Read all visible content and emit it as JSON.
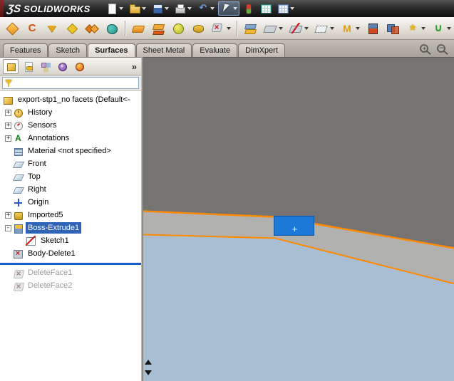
{
  "titlebar": {
    "logo_glyph": "ƷS",
    "brand": "SOLIDWORKS",
    "buttons": [
      {
        "icon": "new-icon",
        "caret": true
      },
      {
        "icon": "open-icon",
        "caret": true
      },
      {
        "icon": "save-icon",
        "caret": true
      },
      {
        "icon": "print-icon",
        "caret": true
      },
      {
        "icon": "undo-icon",
        "caret": true
      },
      {
        "icon": "select-cursor-icon",
        "caret": true,
        "pressed": true
      },
      {
        "icon": "stoplight-icon",
        "caret": false
      },
      {
        "icon": "table-icon",
        "caret": false
      },
      {
        "icon": "window-icon",
        "caret": true
      }
    ]
  },
  "surfaces_toolbar": {
    "buttons": [
      {
        "icon": "extruded-surface-icon"
      },
      {
        "icon": "revolved-surface-icon"
      },
      {
        "icon": "swept-surface-icon"
      },
      {
        "icon": "lofted-surface-icon"
      },
      {
        "icon": "boundary-surface-icon"
      },
      {
        "icon": "filled-surface-icon"
      },
      {
        "separator": true
      },
      {
        "icon": "planar-surface-icon"
      },
      {
        "icon": "offset-surface-icon"
      },
      {
        "icon": "ruled-surface-icon"
      },
      {
        "icon": "radiate-surface-icon"
      },
      {
        "icon": "delete-face-icon",
        "caret": true
      },
      {
        "separator": true
      },
      {
        "icon": "replace-face-icon"
      },
      {
        "icon": "extend-surface-icon",
        "caret": true
      },
      {
        "icon": "trim-surface-icon",
        "caret": true
      },
      {
        "icon": "untrim-surface-icon",
        "caret": true
      },
      {
        "icon": "knit-surface-icon",
        "caret": true
      },
      {
        "icon": "thicken-icon"
      },
      {
        "icon": "intersect-icon"
      },
      {
        "icon": "instant3d-icon",
        "caret": true
      },
      {
        "icon": "curves-icon",
        "caret": true
      }
    ]
  },
  "ribbon_tabs": [
    {
      "label": "Features",
      "active": false
    },
    {
      "label": "Sketch",
      "active": false
    },
    {
      "label": "Surfaces",
      "active": true
    },
    {
      "label": "Sheet Metal",
      "active": false
    },
    {
      "label": "Evaluate",
      "active": false
    },
    {
      "label": "DimXpert",
      "active": false
    }
  ],
  "panel": {
    "tabs": [
      "featuremanager-icon",
      "propertymanager-icon",
      "configurationmanager-icon",
      "dimxpertmanager-icon",
      "displaymanager-icon"
    ],
    "expand_glyph": "»",
    "filter": {
      "value": ""
    },
    "tree": {
      "root": {
        "label": "export-stp1_no facets  (Default<-",
        "icon": "part-icon"
      },
      "items": [
        {
          "label": "History",
          "icon": "history-icon",
          "expander": "+"
        },
        {
          "label": "Sensors",
          "icon": "sensors-icon",
          "expander": "+"
        },
        {
          "label": "Annotations",
          "icon": "annotations-icon",
          "expander": "+"
        },
        {
          "label": "Material <not specified>",
          "icon": "material-icon"
        },
        {
          "label": "Front",
          "icon": "plane-icon"
        },
        {
          "label": "Top",
          "icon": "plane-icon"
        },
        {
          "label": "Right",
          "icon": "plane-icon"
        },
        {
          "label": "Origin",
          "icon": "origin-icon"
        },
        {
          "label": "Imported5",
          "icon": "imported-feature-icon",
          "expander": "+"
        },
        {
          "label": "Boss-Extrude1",
          "icon": "boss-extrude-icon",
          "expander": "-",
          "selected": true
        },
        {
          "label": "Sketch1",
          "icon": "sketch-icon",
          "level": 2
        },
        {
          "label": "Body-Delete1",
          "icon": "body-delete-icon"
        },
        {
          "type": "rollback-bar"
        },
        {
          "label": "DeleteFace1",
          "icon": "delete-face-icon",
          "grayed": true
        },
        {
          "label": "DeleteFace2",
          "icon": "delete-face-icon",
          "grayed": true
        }
      ]
    }
  },
  "viewport": {
    "zoom_icons": [
      "zoom-in-icon",
      "zoom-out-icon"
    ],
    "cursor_glyph": "+",
    "colors": {
      "background": "#757472",
      "chamfer_face": "#b1b1af",
      "bottom_face": "#a9bed3",
      "highlight_edge": "#ff8a00",
      "selection_fill": "#1d79d8",
      "selection_border": "#11549f"
    }
  }
}
